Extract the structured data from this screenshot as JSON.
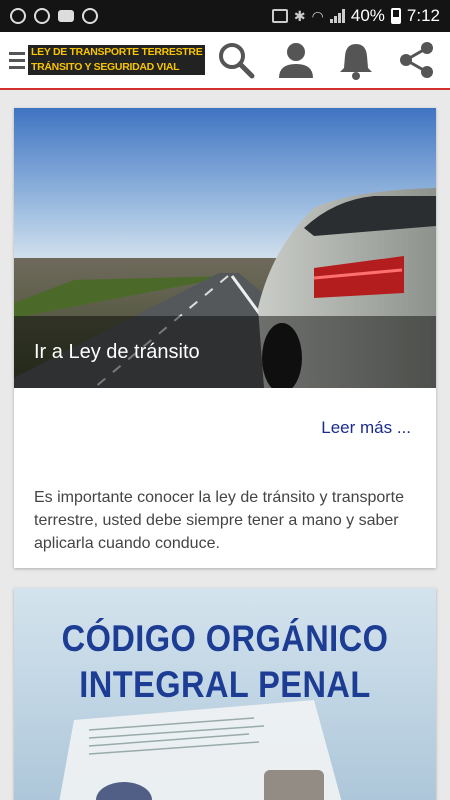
{
  "status_bar": {
    "battery": "40%",
    "time": "7:12"
  },
  "app_bar": {
    "logo_line1": "LEY DE TRANSPORTE TERRESTRE",
    "logo_line2": "TRÁNSITO Y SEGURIDAD VIAL",
    "menu_icon": "hamburger-menu-icon",
    "search_icon": "search-icon",
    "user_icon": "user-icon",
    "bell_icon": "bell-icon",
    "share_icon": "share-icon",
    "accent_color": "#d32f2f"
  },
  "feed": {
    "cards": [
      {
        "title": "Ir a Ley de tránsito",
        "read_more": "Leer más ...",
        "description": "Es importante conocer la ley de tránsito y transporte terrestre, usted debe siempre tener a mano y saber aplicarla cuando conduce."
      },
      {
        "cover_line1": "CÓDIGO ORGÁNICO",
        "cover_line2": "INTEGRAL PENAL"
      }
    ]
  }
}
